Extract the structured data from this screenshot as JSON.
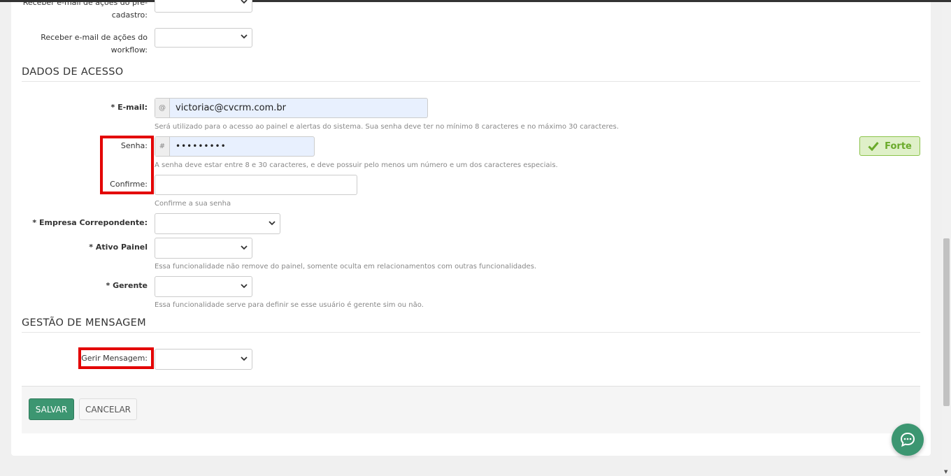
{
  "colors": {
    "accent": "#3c9671",
    "highlight": "#e30000",
    "strength": "#6aaa2a"
  },
  "notifications": {
    "precadastro_label_line1": "Receber e-mail de ações do pré-",
    "precadastro_label_line2": "cadastro:",
    "workflow_label_line1": "Receber e-mail de ações do",
    "workflow_label_line2": "workflow:"
  },
  "access": {
    "section_title": "DADOS DE ACESSO",
    "email_label": "* E-mail:",
    "email_addon": "@",
    "email_value": "victoriac@cvcrm.com.br",
    "email_help": "Será utilizado para o acesso ao painel e alertas do sistema. Sua senha deve ter no mínimo 8 caracteres e no máximo 30 caracteres.",
    "password_label": "Senha:",
    "password_addon": "#",
    "password_value": "•••••••••",
    "password_help": "A senha deve estar entre 8 e 30 caracteres, e deve possuir pelo menos um número e um dos caracteres especiais.",
    "strength_label": "Forte",
    "confirm_label": "Confirme:",
    "confirm_help": "Confirme a sua senha",
    "company_label": "* Empresa Correpondente:",
    "active_label": "* Ativo Painel",
    "active_help": "Essa funcionalidade não remove do painel, somente oculta em relacionamentos com outras funcionalidades.",
    "manager_label": "* Gerente",
    "manager_help": "Essa funcionalidade serve para definir se esse usuário é gerente sim ou não."
  },
  "messages": {
    "section_title": "GESTÃO DE MENSAGEM",
    "manage_label": "Gerir Mensagem:"
  },
  "actions": {
    "save_label": "SALVAR",
    "cancel_label": "CANCELAR"
  },
  "icons": {
    "chevron": "chevron-down-icon",
    "check": "check-icon",
    "chat": "chat-bubble-icon"
  }
}
